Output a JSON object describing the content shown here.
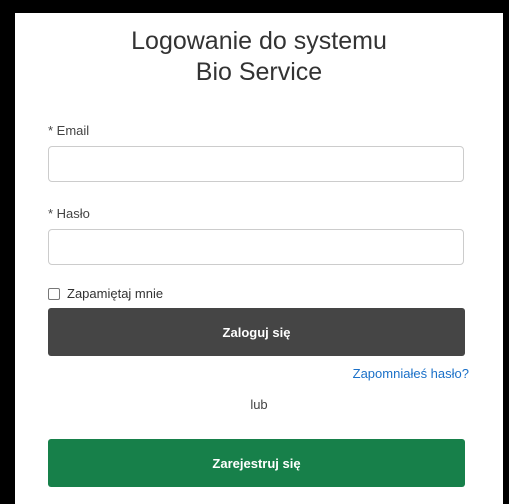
{
  "header": {
    "title_line1": "Logowanie do systemu",
    "title_line2": "Bio Service"
  },
  "form": {
    "email_label": "* Email",
    "email_value": "",
    "password_label": "* Hasło",
    "password_value": "",
    "remember_label": "Zapamiętaj mnie",
    "remember_checked": false,
    "login_button": "Zaloguj się",
    "forgot_link": "Zapomniałeś hasło?",
    "or_text": "lub",
    "register_button": "Zarejestruj się"
  },
  "colors": {
    "login_button_bg": "#454545",
    "register_button_bg": "#17804a",
    "link": "#1a70c8"
  }
}
